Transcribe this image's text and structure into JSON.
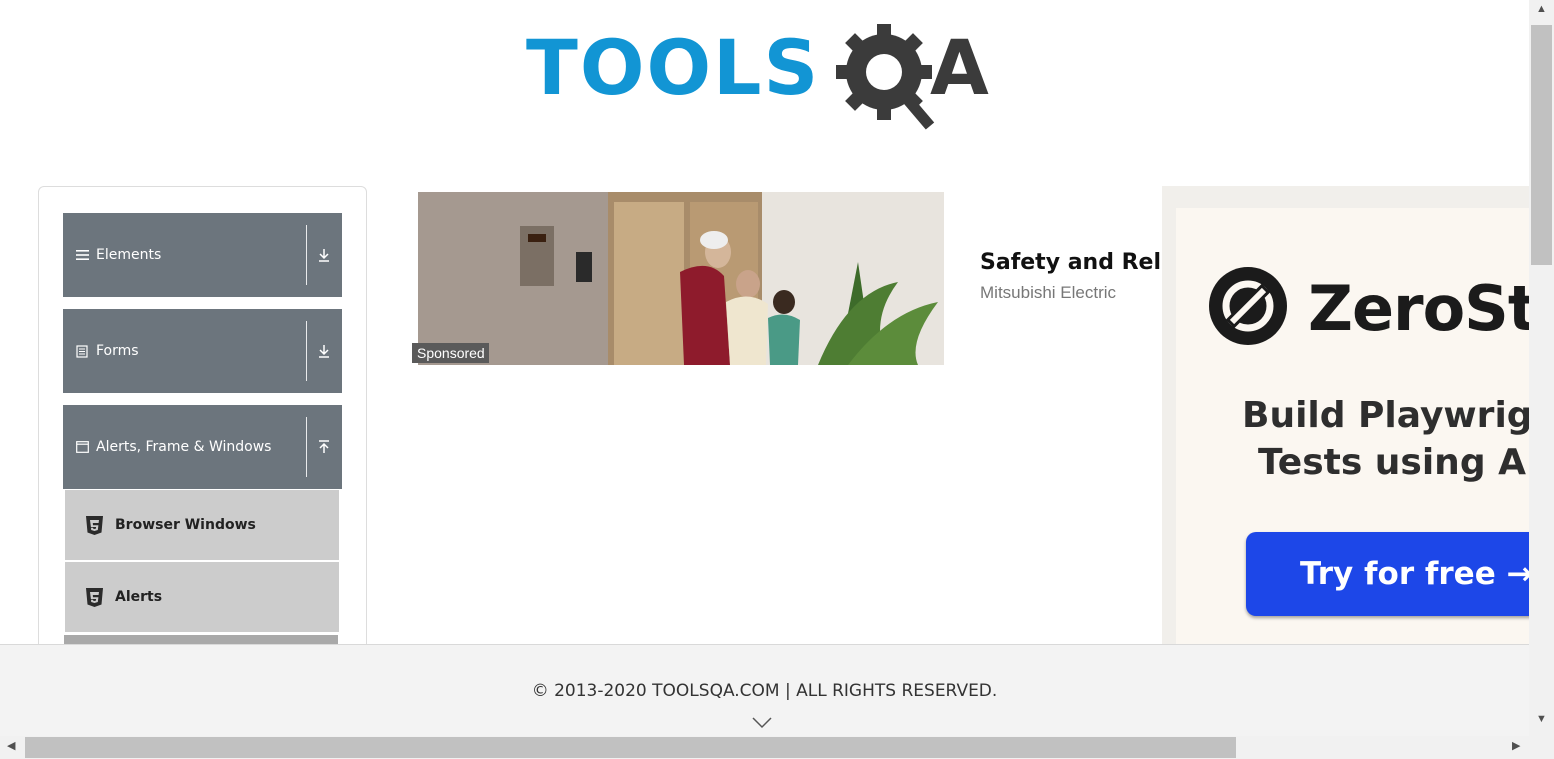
{
  "logo": {
    "text": "TOOLS",
    "suffix": "A",
    "colors": {
      "blue": "#1295d4",
      "dark": "#3b3b3b"
    }
  },
  "sidebar": {
    "groups": [
      {
        "label": "Elements",
        "icon": "menu-lines-icon",
        "toggle": "download-arrow-icon",
        "expanded": false
      },
      {
        "label": "Forms",
        "icon": "form-document-icon",
        "toggle": "download-arrow-icon",
        "expanded": false
      },
      {
        "label": "Alerts, Frame & Windows",
        "icon": "window-icon",
        "toggle": "upload-arrow-icon",
        "expanded": true
      }
    ],
    "items": [
      {
        "label": "Browser Windows",
        "icon": "html5-icon"
      },
      {
        "label": "Alerts",
        "icon": "html5-icon"
      }
    ]
  },
  "ad": {
    "badge": "Sponsored",
    "title": "Safety and Relia",
    "advertiser": "Mitsubishi Electric"
  },
  "right_ad": {
    "brand": "ZeroSte",
    "tagline_line1": "Build Playwrigh",
    "tagline_line2": "Tests using A",
    "cta": "Try for free →",
    "cta_color": "#1d47e8"
  },
  "footer": {
    "text": "© 2013-2020 TOOLSQA.COM | ALL RIGHTS RESERVED."
  }
}
